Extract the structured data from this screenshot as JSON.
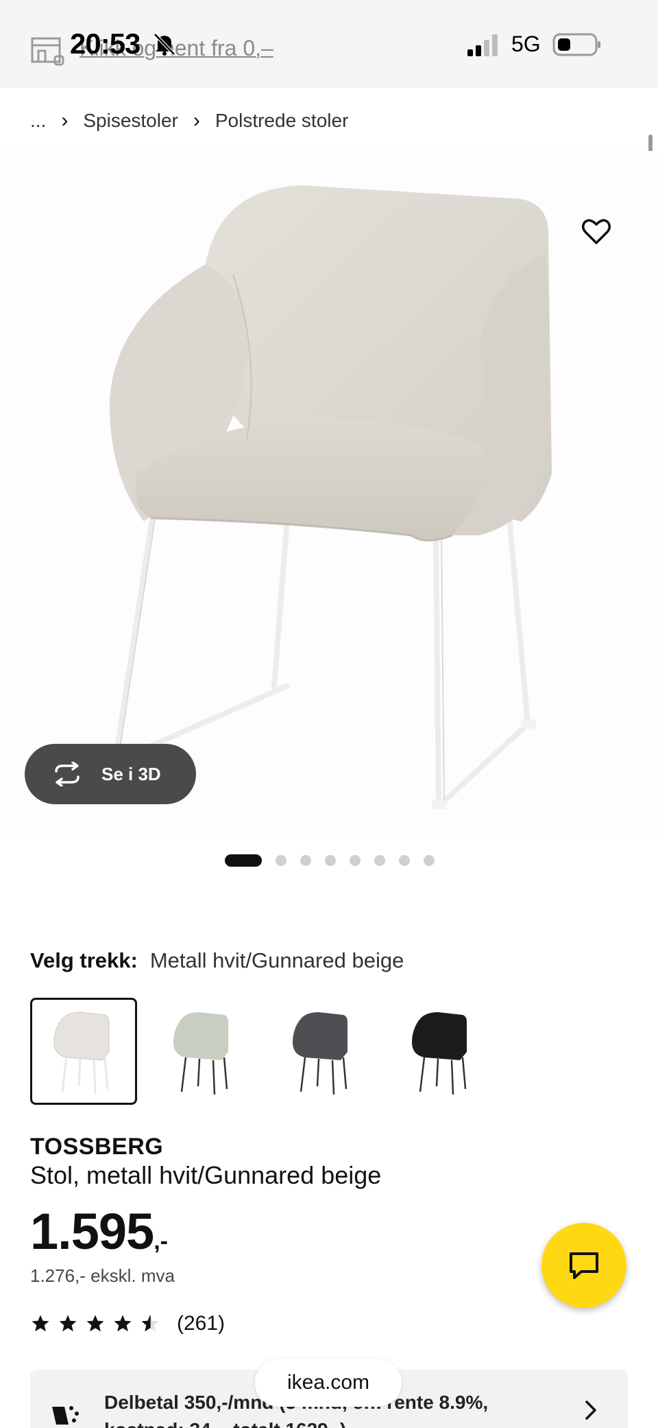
{
  "status_bar": {
    "time": "20:53",
    "network": "5G",
    "banner_text": "Klikk og hent fra 0,–"
  },
  "breadcrumb": {
    "items": [
      "...",
      "Spisestoler",
      "Polstrede stoler"
    ],
    "separator": "›"
  },
  "product_image": {
    "alt": "TOSSBERG chair",
    "view3d_label": "Se i 3D",
    "dots_count": 8,
    "active_dot": 0
  },
  "fabric": {
    "label": "Velg trekk:",
    "selected": "Metall hvit/Gunnared beige",
    "options": [
      {
        "name": "Metall hvit/Gunnared beige",
        "color": "#e6e3de",
        "leg_color": "#ffffff",
        "selected": true
      },
      {
        "name": "green",
        "color": "#c7cfc2",
        "leg_color": "#333333",
        "selected": false
      },
      {
        "name": "dark grey",
        "color": "#4d4f52",
        "leg_color": "#333333",
        "selected": false
      },
      {
        "name": "black",
        "color": "#1c1c1c",
        "leg_color": "#333333",
        "selected": false
      }
    ]
  },
  "product": {
    "name": "TOSSBERG",
    "description": "Stol, metall hvit/Gunnared beige",
    "price_main": "1.595",
    "price_suffix": ",-",
    "price_ex_vat": "1.276,- ekskl. mva",
    "rating": 4.5,
    "review_count": "(261)"
  },
  "installment": {
    "line1": "Delbetal 350,-/mnd (3 mnd, eff. rente 8.9%,",
    "line2": "kostnad: 34,-, totalt 1629,-)"
  },
  "url_bar": {
    "domain": "ikea.com"
  },
  "colors": {
    "accent": "#ffd814",
    "dark_button": "#4a4a4a"
  }
}
